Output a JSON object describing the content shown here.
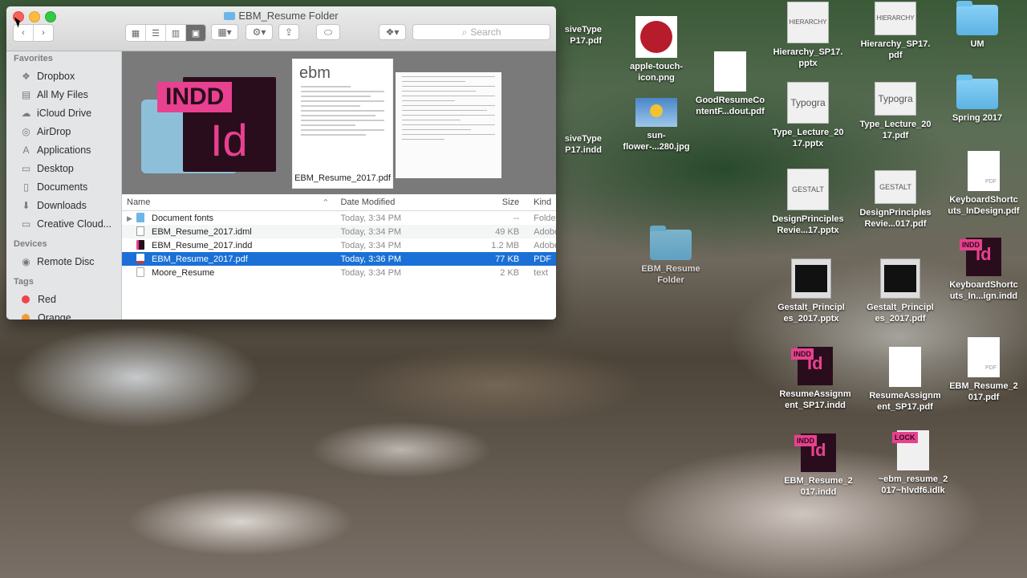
{
  "window": {
    "title": "EBM_Resume Folder",
    "search_placeholder": "Search"
  },
  "sidebar": {
    "favorites_header": "Favorites",
    "favorites": [
      {
        "label": "Dropbox",
        "icon": "dropbox-icon"
      },
      {
        "label": "All My Files",
        "icon": "all-files-icon"
      },
      {
        "label": "iCloud Drive",
        "icon": "cloud-icon"
      },
      {
        "label": "AirDrop",
        "icon": "airdrop-icon"
      },
      {
        "label": "Applications",
        "icon": "applications-icon"
      },
      {
        "label": "Desktop",
        "icon": "desktop-icon"
      },
      {
        "label": "Documents",
        "icon": "documents-icon"
      },
      {
        "label": "Downloads",
        "icon": "downloads-icon"
      },
      {
        "label": "Creative Cloud...",
        "icon": "folder-icon"
      }
    ],
    "devices_header": "Devices",
    "devices": [
      {
        "label": "Remote Disc",
        "icon": "disc-icon"
      }
    ],
    "tags_header": "Tags",
    "tags": [
      {
        "label": "Red",
        "color": "#f0434b"
      },
      {
        "label": "Orange",
        "color": "#f59a34"
      }
    ]
  },
  "coverflow": {
    "indd_flag": "INDD",
    "indd_letters": "Id",
    "doc_header": "ebm",
    "selected_label": "EBM_Resume_2017.pdf"
  },
  "list": {
    "columns": {
      "name": "Name",
      "date": "Date Modified",
      "size": "Size",
      "kind": "Kind"
    },
    "rows": [
      {
        "name": "Document fonts",
        "date": "Today, 3:34 PM",
        "size": "--",
        "kind": "Folder",
        "type": "folder"
      },
      {
        "name": "EBM_Resume_2017.idml",
        "date": "Today, 3:34 PM",
        "size": "49 KB",
        "kind": "Adobe",
        "type": "idml"
      },
      {
        "name": "EBM_Resume_2017.indd",
        "date": "Today, 3:34 PM",
        "size": "1.2 MB",
        "kind": "Adobe",
        "type": "indd"
      },
      {
        "name": "EBM_Resume_2017.pdf",
        "date": "Today, 3:36 PM",
        "size": "77 KB",
        "kind": "PDF",
        "type": "pdf"
      },
      {
        "name": "Moore_Resume",
        "date": "Today, 3:34 PM",
        "size": "2 KB",
        "kind": "text",
        "type": "text"
      }
    ]
  },
  "desktop": {
    "partial1": "siveType\nP17.pdf",
    "partial2": "siveType\nP17.indd",
    "apple_touch": "apple-touch-\nicon.png",
    "sunflower": "sun-\nflower-...280.jpg",
    "good_resume": "GoodResumeCo\nntentF...dout.pdf",
    "hier_pptx": "Hierarchy_SP17.\npptx",
    "hier_pdf": "Hierarchy_SP17.\npdf",
    "um": "UM",
    "spring": "Spring 2017",
    "type_pptx": "Type_Lecture_20\n17.pptx",
    "type_pdf": "Type_Lecture_20\n17.pdf",
    "keyboard_pdf": "KeyboardShortc\nuts_InDesign.pdf",
    "design_pptx": "DesignPrinciples\nRevie...17.pptx",
    "design_pdf": "DesignPrinciples\nRevie...017.pdf",
    "ebm_folder": "EBM_Resume\nFolder",
    "keyboard_indd": "KeyboardShortc\nuts_In...ign.indd",
    "gestalt_pptx": "Gestalt_Principl\nes_2017.pptx",
    "gestalt_pdf": "Gestalt_Principl\nes_2017.pdf",
    "resume_indd": "ResumeAssignm\nent_SP17.indd",
    "resume_pdf": "ResumeAssignm\nent_SP17.pdf",
    "ebm_pdf": "EBM_Resume_2\n017.pdf",
    "ebm_indd": "EBM_Resume_2\n017.indd",
    "lock_file": "~ebm_resume_2\n017~hlvdf6.idlk",
    "indd_flag": "INDD",
    "lock_flag": "LOCK",
    "hier_thumb": "HIERARCHY",
    "typo_thumb": "Typogra",
    "gestalt_thumb": "GESTALT"
  }
}
